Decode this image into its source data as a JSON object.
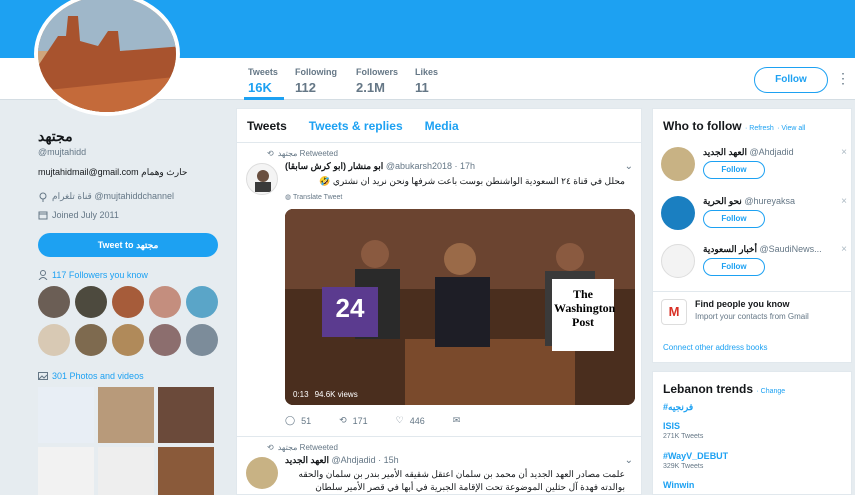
{
  "profile": {
    "name": "مجتهد",
    "handle": "@mujtahidd",
    "bio": "mujtahidmail@gmail.com حارث وهمام",
    "channel": "قناة تلغرام @mujtahiddchannel",
    "joined": "Joined July 2011",
    "tweet_to": "Tweet to مجتهد",
    "followers_you_know": "117 Followers you know",
    "photos_videos": "301 Photos and videos"
  },
  "stats": [
    {
      "label": "Tweets",
      "value": "16K"
    },
    {
      "label": "Following",
      "value": "112"
    },
    {
      "label": "Followers",
      "value": "2.1M"
    },
    {
      "label": "Likes",
      "value": "11"
    }
  ],
  "header": {
    "follow_label": "Follow",
    "more_icon": "more-dots-icon"
  },
  "tabs": [
    "Tweets",
    "Tweets & replies",
    "Media"
  ],
  "tweets": [
    {
      "retweeted_by": "مجتهد Retweeted",
      "author": "(ابو منشار (ابو كرش سابقا",
      "handle": "@abukarsh2018",
      "time": "· 17h",
      "text": "محلل في قناة ٢٤ السعودية الواشنطن بوست باعت شرفها ونحن نريد ان نشتري 🤣",
      "translate": "Translate Tweet",
      "video_time": "0:13",
      "video_views": "94.6K views",
      "replies": "51",
      "retweets": "171",
      "likes": "446",
      "channel_label": "24",
      "paper_label": "The Washington Post"
    },
    {
      "retweeted_by": "مجتهد Retweeted",
      "author": "العهد الجديد",
      "handle": "@Ahdjadid",
      "time": "· 15h",
      "text": "علمت مصادر العهد الجديد أن محمد بن سلمان اعتقل شقيقه الأمير بندر بن سلمان والحقه بوالدته فهدة آل حثلين الموضوعة تحت الإقامة الجبرية في أبها في قصر الأمير سلطان"
    }
  ],
  "who_to_follow": {
    "title": "Who to follow",
    "refresh": "· Refresh",
    "view_all": "· View all",
    "suggestions": [
      {
        "name": "العهد الجديد",
        "handle": "@Ahdjadid",
        "follow": "Follow"
      },
      {
        "name": "نحو الحرية",
        "handle": "@hureyaksa",
        "follow": "Follow"
      },
      {
        "name": "أخبار السعودية",
        "handle": "@SaudiNews...",
        "follow": "Follow"
      }
    ],
    "find_people": "Find people you know",
    "find_people_sub": "Import your contacts from Gmail",
    "connect": "Connect other address books"
  },
  "trends": {
    "title": "Lebanon trends",
    "change": "· Change",
    "items": [
      {
        "name": "#فرنجيه",
        "count": ""
      },
      {
        "name": "ISIS",
        "count": "271K Tweets"
      },
      {
        "name": "#WayV_DEBUT",
        "count": "329K Tweets"
      },
      {
        "name": "Winwin",
        "count": ""
      }
    ]
  },
  "colors": {
    "accent": "#1da1f2",
    "background": "#e6ecf0",
    "muted": "#657786"
  }
}
